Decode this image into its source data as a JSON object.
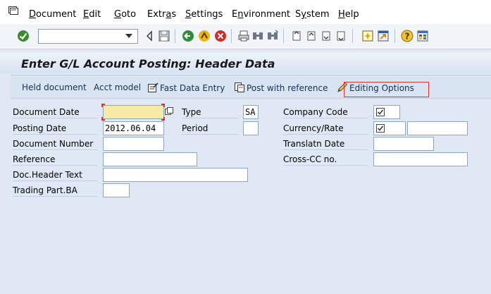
{
  "menu": {
    "items": [
      {
        "label": "Document",
        "u": "D",
        "rest": "ocument"
      },
      {
        "label": "Edit",
        "u": "E",
        "rest": "dit"
      },
      {
        "label": "Goto",
        "u": "G",
        "rest": "oto"
      },
      {
        "label": "Extras",
        "pre": "Extr",
        "u": "a",
        "rest": "s"
      },
      {
        "label": "Settings",
        "u": "S",
        "rest": "ettings"
      },
      {
        "label": "Environment",
        "pre": "E",
        "u": "n",
        "rest": "vironment"
      },
      {
        "label": "System",
        "pre": "S",
        "u": "y",
        "rest": "stem"
      },
      {
        "label": "Help",
        "u": "H",
        "rest": "elp"
      }
    ]
  },
  "toolbar": {
    "command_value": ""
  },
  "title": "Enter G/L Account Posting: Header Data",
  "app_toolbar": {
    "held_document": "Held document",
    "acct_model": "Acct model",
    "fast_data_entry": "Fast Data Entry",
    "post_with_reference": "Post with reference",
    "editing_options": "Editing Options"
  },
  "form": {
    "document_date": {
      "label": "Document Date",
      "value": ""
    },
    "posting_date": {
      "label": "Posting Date",
      "value": "2012.06.04"
    },
    "document_number": {
      "label": "Document Number",
      "value": ""
    },
    "reference": {
      "label": "Reference",
      "value": ""
    },
    "doc_header_text": {
      "label": "Doc.Header Text",
      "value": ""
    },
    "trading_part_ba": {
      "label": "Trading Part.BA",
      "value": ""
    },
    "type": {
      "label": "Type",
      "value": "SA"
    },
    "period": {
      "label": "Period",
      "value": ""
    },
    "company_code": {
      "label": "Company Code"
    },
    "currency_rate": {
      "label": "Currency/Rate",
      "value": ""
    },
    "translatn_date": {
      "label": "Translatn Date",
      "value": ""
    },
    "cross_cc_no": {
      "label": "Cross-CC no.",
      "value": ""
    }
  },
  "colors": {
    "background": "#dfe8f4",
    "required_field": "#f7e9a6",
    "highlight_box": "#e0322f"
  }
}
